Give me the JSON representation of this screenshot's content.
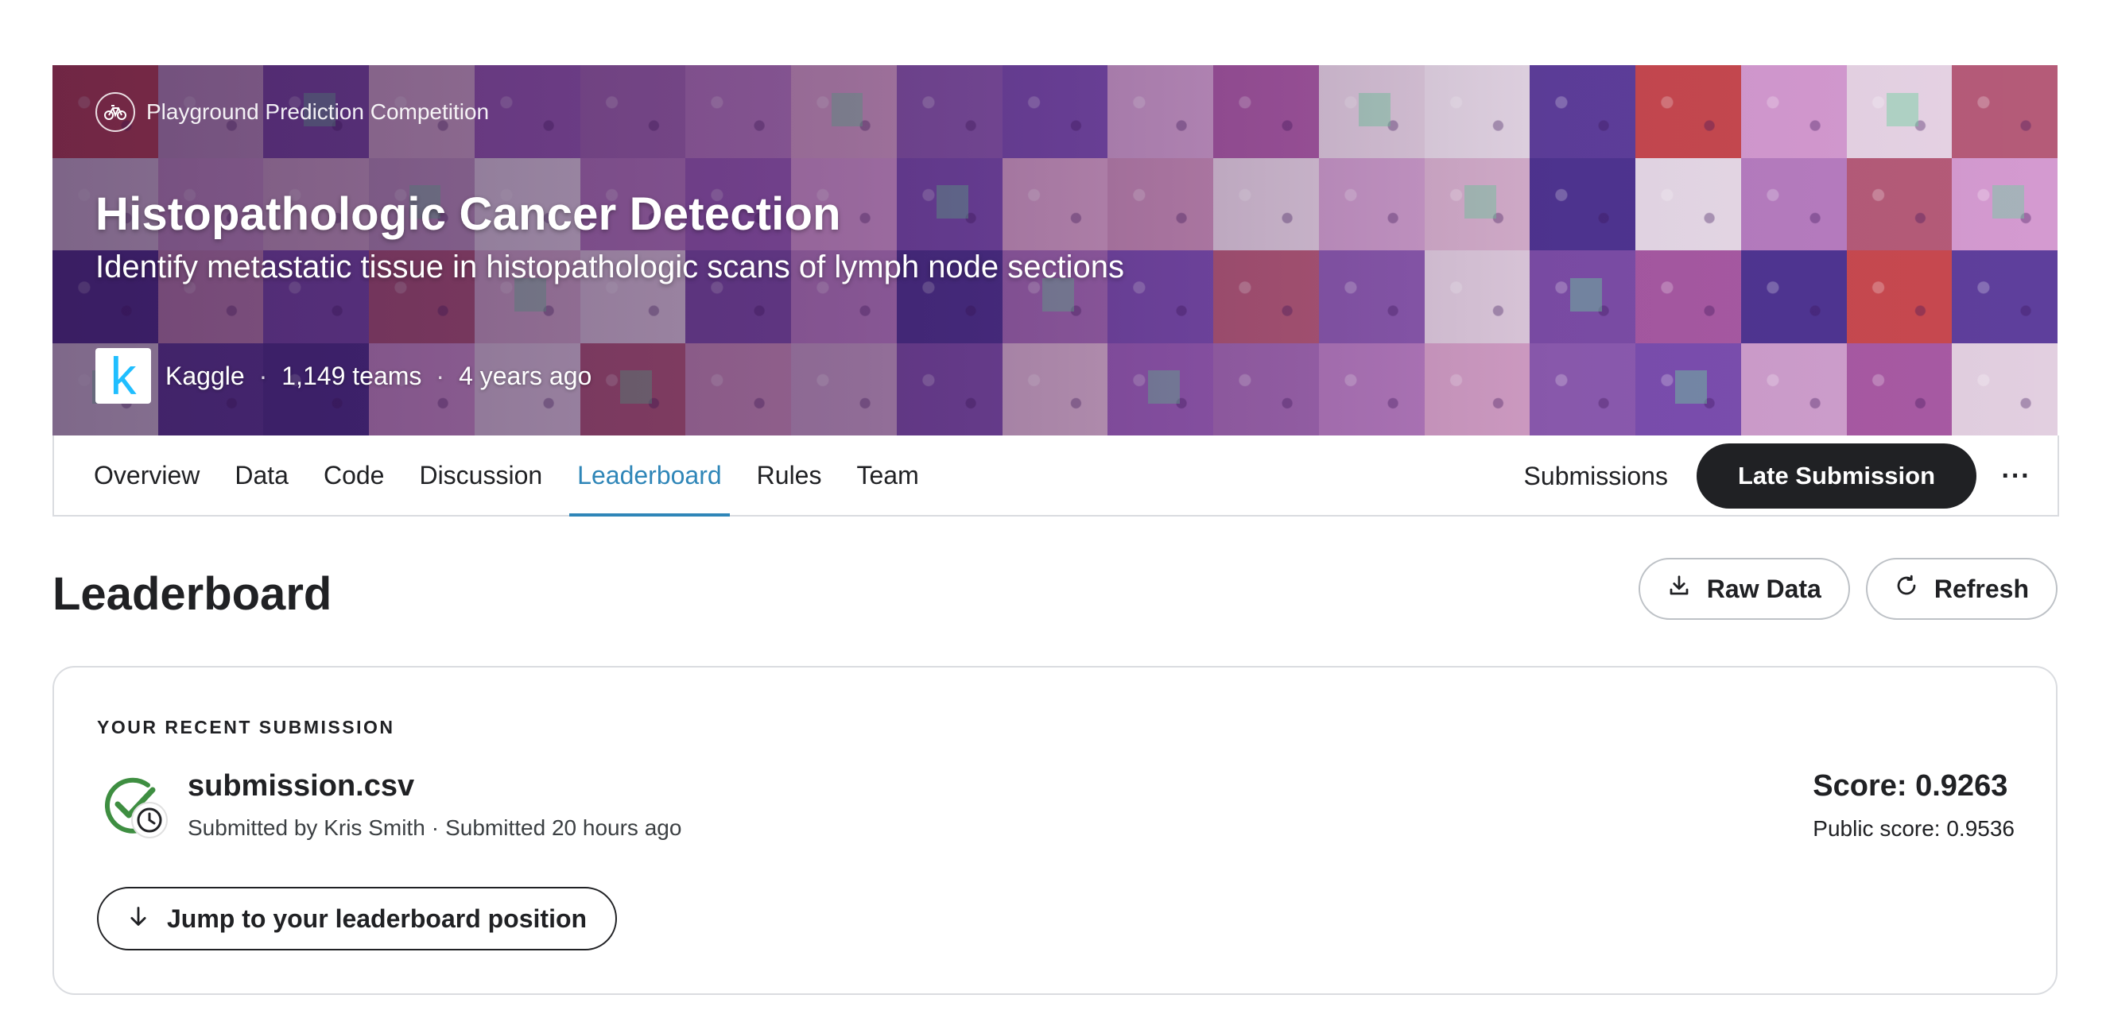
{
  "banner": {
    "competition_type": "Playground Prediction Competition",
    "competition_type_icon": "bicycle-icon",
    "title": "Histopathologic Cancer Detection",
    "subtitle": "Identify metastatic tissue in histopathologic scans of lymph node sections",
    "host_logo_letter": "k",
    "host": "Kaggle",
    "separator": "·",
    "teams": "1,149 teams",
    "age": "4 years ago",
    "tile_colors": [
      "#c98fb8",
      "#a85aa3",
      "#d9b3cf",
      "#5e3f9c",
      "#b77dc0",
      "#e6d3e4",
      "#7c4fb0",
      "#c7a0c6",
      "#e2cfe0",
      "#9a5fb7",
      "#4f3592",
      "#d6a2c8",
      "#b55b78",
      "#cf9fcd",
      "#7d4ea8",
      "#e8dbe8",
      "#a46bb4",
      "#d49ad0",
      "#8d5cb1"
    ],
    "accent_tile": "#c8494f"
  },
  "tabs": {
    "items": [
      {
        "label": "Overview"
      },
      {
        "label": "Data"
      },
      {
        "label": "Code"
      },
      {
        "label": "Discussion"
      },
      {
        "label": "Leaderboard"
      },
      {
        "label": "Rules"
      },
      {
        "label": "Team"
      }
    ],
    "active": "Leaderboard",
    "submissions_label": "Submissions",
    "late_submission_label": "Late Submission",
    "more_label": "···"
  },
  "leaderboard": {
    "title": "Leaderboard",
    "raw_data_label": "Raw Data",
    "refresh_label": "Refresh"
  },
  "recent_submission": {
    "section_label": "YOUR RECENT SUBMISSION",
    "file_name": "submission.csv",
    "submitted_by": "Submitted by Kris Smith",
    "separator": "·",
    "submitted_when": "Submitted 20 hours ago",
    "score": "Score: 0.9263",
    "public_score": "Public score: 0.9536",
    "jump_label": "Jump to your leaderboard position",
    "status_color": "#3e8e41"
  }
}
